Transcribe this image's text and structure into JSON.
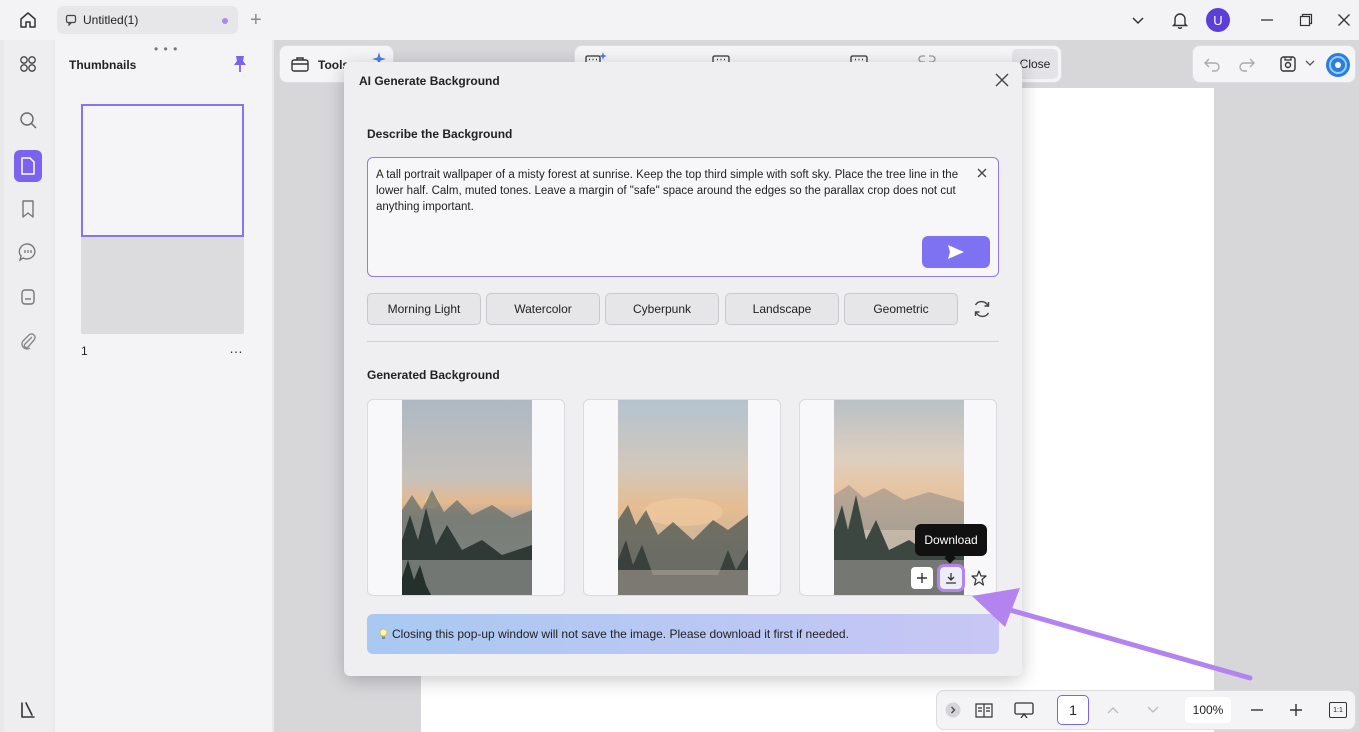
{
  "window": {
    "tab_title": "Untitled(1)",
    "avatar_letter": "U"
  },
  "sidebar": {
    "panel_title": "Thumbnails",
    "page_number": "1",
    "more": "…"
  },
  "toolbar": {
    "tools_label": "Tools",
    "close_label": "Close"
  },
  "bottombar": {
    "current_page": "1",
    "zoom": "100%",
    "fit_label": "1:1"
  },
  "modal": {
    "title": "AI Generate Background",
    "describe_label": "Describe the Background",
    "prompt_text": "A tall portrait wallpaper of a misty forest at sunrise. Keep the top third simple with soft sky. Place the tree line in the lower half. Calm, muted tones. Leave a margin of \"safe\" space around the edges so the parallax crop does not cut anything important.",
    "styles": [
      "Morning Light",
      "Watercolor",
      "Cyberpunk",
      "Landscape",
      "Geometric"
    ],
    "generated_label": "Generated Background",
    "tooltip": "Download",
    "notice": "Closing this pop-up window will not save the image. Please download it first if needed."
  },
  "colors": {
    "accent": "#7b63f0",
    "send_button": "#7e72f2",
    "highlight": "#b184ef",
    "arrow": "#b384f0"
  }
}
